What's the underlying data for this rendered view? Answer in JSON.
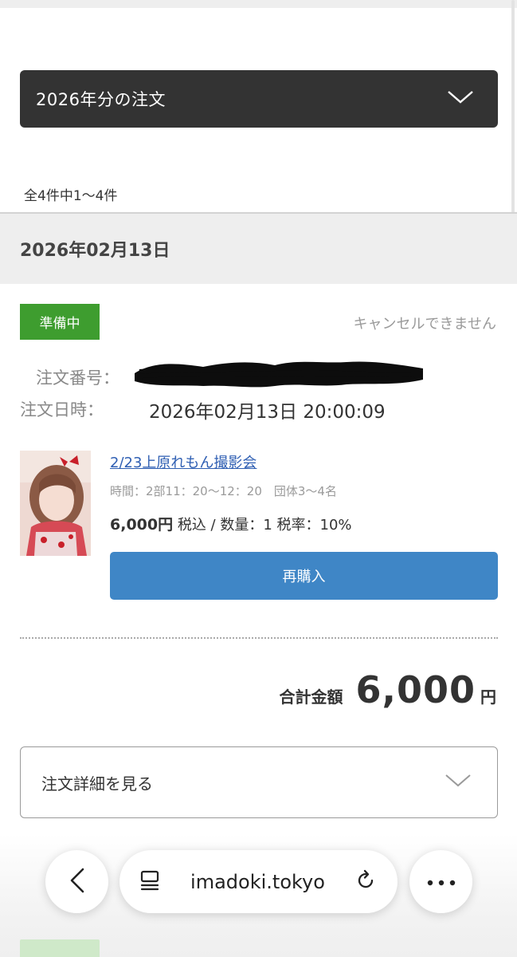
{
  "filter": {
    "year_label": "2026年分の注文"
  },
  "results": {
    "count_text": "全4件中1〜4件"
  },
  "order_group": {
    "date": "2026年02月13日"
  },
  "order": {
    "status": "準備中",
    "status_color": "#3e9d2f",
    "cancel_note": "キャンセルできません",
    "number_label": "注文番号：",
    "time_label": "注文日時：",
    "time_value": "2026年02月13日 20:00:09"
  },
  "product": {
    "title": "2/23上原れもん撮影会",
    "time_info": "時間：2部11：20〜12：20　団体3〜4名",
    "price": "6,000円",
    "price_suffix": " 税込 / 数量：1 税率：10%",
    "rebuy_label": "再購入"
  },
  "total": {
    "label": "合計金額",
    "value": "6,000",
    "unit": "円"
  },
  "details": {
    "label": "注文詳細を見る"
  },
  "browser": {
    "url": "imadoki.tokyo",
    "back_icon": "chevron-left-icon",
    "reader_icon": "reader-mode-icon",
    "reload_icon": "reload-icon",
    "more_icon": "more-icon"
  },
  "colors": {
    "primary_button": "#3f86c6",
    "dark_select": "#333333",
    "link": "#2f5fb3"
  }
}
